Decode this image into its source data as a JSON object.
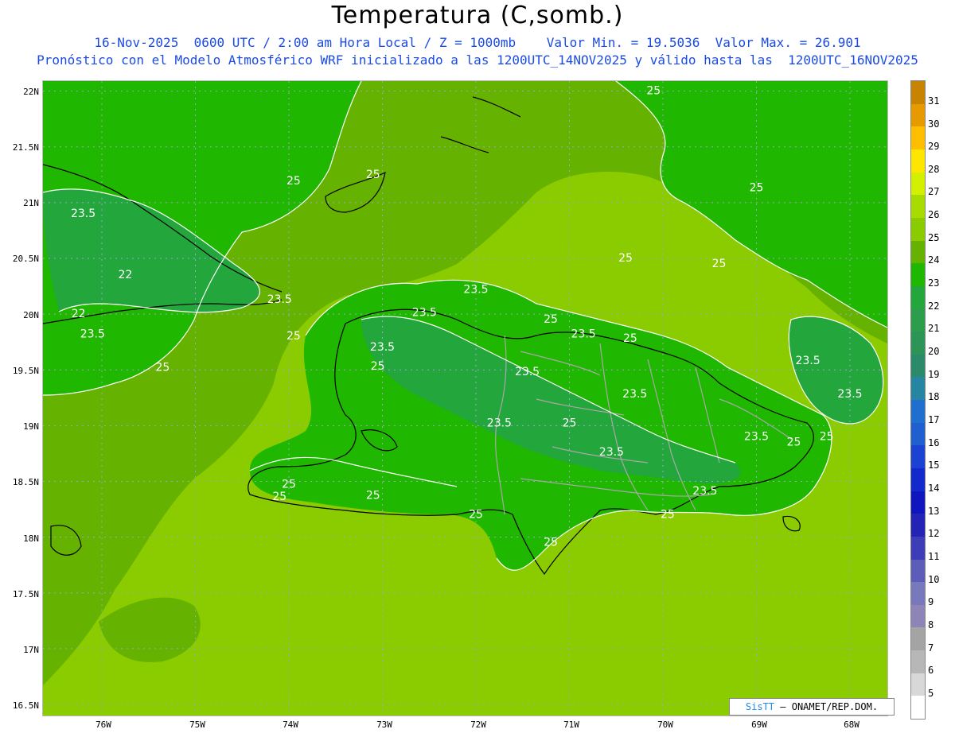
{
  "header": {
    "title": "Temperatura (C,somb.)",
    "line1": "16-Nov-2025  0600 UTC / 2:00 am Hora Local / Z = 1000mb    Valor Min. = 19.5036  Valor Max. = 26.901",
    "line2": "Pronóstico con el Modelo Atmosférico WRF inicializado a las 1200UTC_14NOV2025 y válido hasta las  1200UTC_16NOV2025"
  },
  "axes": {
    "lat_labels": [
      "22N",
      "21.5N",
      "21N",
      "20.5N",
      "20N",
      "19.5N",
      "19N",
      "18.5N",
      "18N",
      "17.5N",
      "17N",
      "16.5N"
    ],
    "lon_labels": [
      "76W",
      "75W",
      "74W",
      "73W",
      "72W",
      "71W",
      "70W",
      "69W",
      "68W"
    ]
  },
  "contour_labels": [
    {
      "text": "25",
      "lon": -70.1,
      "lat": 22.0
    },
    {
      "text": "25",
      "lon": -73.95,
      "lat": 21.19
    },
    {
      "text": "25",
      "lon": -73.1,
      "lat": 21.25
    },
    {
      "text": "25",
      "lon": -69.0,
      "lat": 21.13
    },
    {
      "text": "23.5",
      "lon": -76.2,
      "lat": 20.9
    },
    {
      "text": "25",
      "lon": -70.4,
      "lat": 20.5
    },
    {
      "text": "25",
      "lon": -69.4,
      "lat": 20.45
    },
    {
      "text": "22",
      "lon": -75.75,
      "lat": 20.35
    },
    {
      "text": "23.5",
      "lon": -74.1,
      "lat": 20.13
    },
    {
      "text": "23.5",
      "lon": -72.0,
      "lat": 20.22
    },
    {
      "text": "22",
      "lon": -76.25,
      "lat": 20.0
    },
    {
      "text": "23.5",
      "lon": -72.55,
      "lat": 20.01
    },
    {
      "text": "23.5",
      "lon": -76.1,
      "lat": 19.82
    },
    {
      "text": "25",
      "lon": -73.95,
      "lat": 19.8
    },
    {
      "text": "25",
      "lon": -71.2,
      "lat": 19.95
    },
    {
      "text": "23.5",
      "lon": -70.85,
      "lat": 19.82
    },
    {
      "text": "25",
      "lon": -70.35,
      "lat": 19.78
    },
    {
      "text": "23.5",
      "lon": -73.0,
      "lat": 19.7
    },
    {
      "text": "25",
      "lon": -76.8,
      "lat": 19.55
    },
    {
      "text": "25",
      "lon": -75.35,
      "lat": 19.52
    },
    {
      "text": "25",
      "lon": -73.05,
      "lat": 19.53
    },
    {
      "text": "23.5",
      "lon": -71.45,
      "lat": 19.48
    },
    {
      "text": "23.5",
      "lon": -68.45,
      "lat": 19.58
    },
    {
      "text": "23.5",
      "lon": -70.3,
      "lat": 19.28
    },
    {
      "text": "23.5",
      "lon": -68.0,
      "lat": 19.28
    },
    {
      "text": "23.5",
      "lon": -71.75,
      "lat": 19.02
    },
    {
      "text": "25",
      "lon": -71.0,
      "lat": 19.02
    },
    {
      "text": "23.5",
      "lon": -69.0,
      "lat": 18.9
    },
    {
      "text": "25",
      "lon": -68.6,
      "lat": 18.85
    },
    {
      "text": "25",
      "lon": -68.25,
      "lat": 18.9
    },
    {
      "text": "23.5",
      "lon": -70.55,
      "lat": 18.76
    },
    {
      "text": "25",
      "lon": -74.0,
      "lat": 18.47
    },
    {
      "text": "25",
      "lon": -74.1,
      "lat": 18.36
    },
    {
      "text": "25",
      "lon": -73.1,
      "lat": 18.37
    },
    {
      "text": "23.5",
      "lon": -69.55,
      "lat": 18.41
    },
    {
      "text": "25",
      "lon": -72.0,
      "lat": 18.2
    },
    {
      "text": "25",
      "lon": -69.95,
      "lat": 18.2
    },
    {
      "text": "25",
      "lon": -71.2,
      "lat": 17.95
    }
  ],
  "colorbar": {
    "labels": [
      "31",
      "30",
      "29",
      "28",
      "27",
      "26",
      "25",
      "24",
      "23",
      "22",
      "21",
      "20",
      "19",
      "18",
      "17",
      "16",
      "15",
      "14",
      "13",
      "12",
      "11",
      "10",
      "9",
      "8",
      "7",
      "6",
      "5"
    ],
    "colors": [
      "#c88400",
      "#e69a00",
      "#ffbe00",
      "#ffe600",
      "#d2f000",
      "#a8dc00",
      "#8acc00",
      "#66b200",
      "#1fb700",
      "#23a63c",
      "#2c9d4b",
      "#2d9458",
      "#2a8a6a",
      "#2685a0",
      "#1f6fcf",
      "#1f5fd0",
      "#1b42d2",
      "#1229cc",
      "#0f16c0",
      "#2323b6",
      "#3d3db7",
      "#5b5db8",
      "#7878bc",
      "#8e84b8",
      "#a4a4a4",
      "#b7b7b7",
      "#d8d8d8",
      "#ffffff"
    ]
  },
  "credit": {
    "brand": "SisTT",
    "text": "– ONAMET/REP.DOM."
  }
}
